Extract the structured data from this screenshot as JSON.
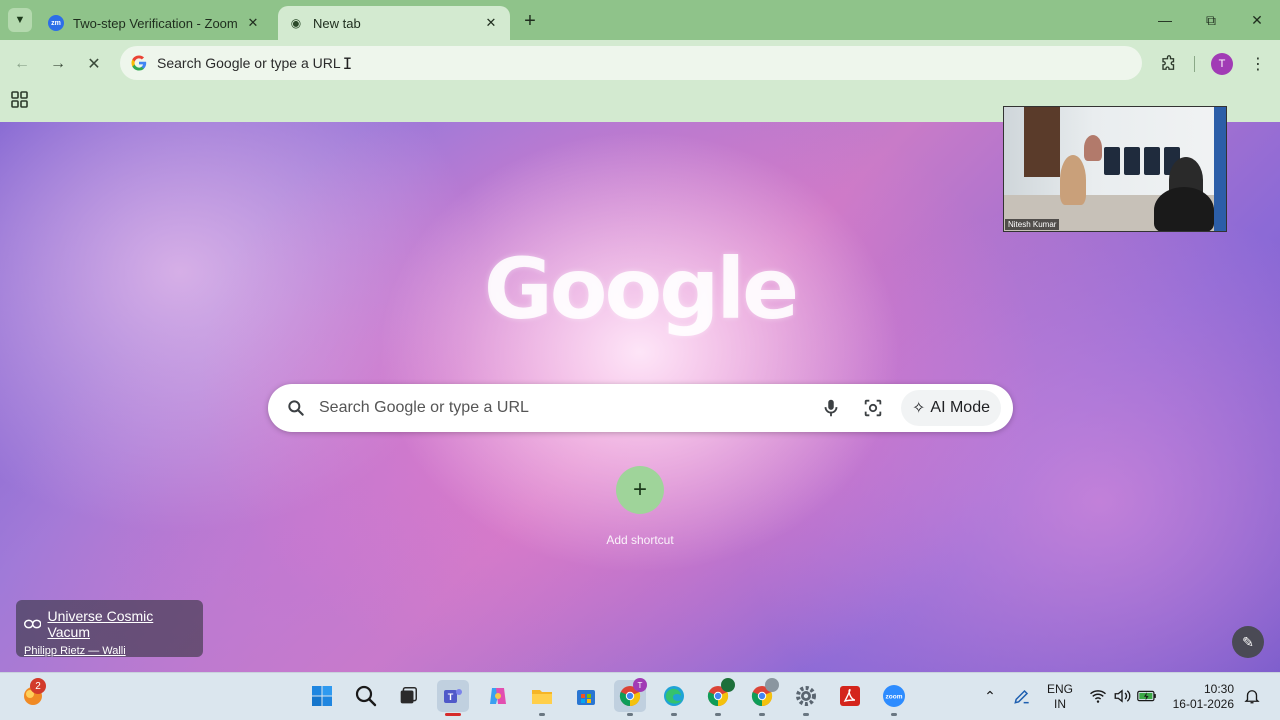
{
  "tabs": [
    {
      "title": "Two-step Verification - Zoom",
      "favicon": "zoom-icon",
      "active": false
    },
    {
      "title": "New tab",
      "favicon": "chrome-newtab-icon",
      "active": true
    }
  ],
  "toolbar": {
    "omnibox_placeholder": "Search Google or type a URL",
    "profile_initial": "T"
  },
  "page": {
    "logo": "Google",
    "search_placeholder": "Search Google or type a URL",
    "ai_mode_label": "AI Mode",
    "add_shortcut_label": "Add shortcut",
    "attribution": {
      "name": "Universe Cosmic Vacum",
      "credit": "Philipp Rietz — Walli"
    }
  },
  "video_overlay": {
    "participant_name": "Nitesh Kumar"
  },
  "taskbar": {
    "widget_badge": "2",
    "teams_badge": "T",
    "language_line1": "ENG",
    "language_line2": "IN",
    "time": "10:30",
    "date": "16-01-2026"
  },
  "colors": {
    "tab_strip": "#8fc38a",
    "toolbar": "#d3ead0",
    "accent_green": "#9fd49a",
    "profile_avatar": "#a13bb5"
  }
}
